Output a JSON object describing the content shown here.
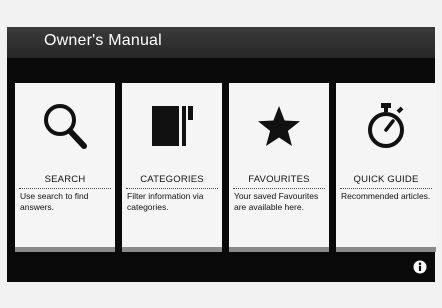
{
  "header": {
    "title": "Owner's Manual"
  },
  "cards": [
    {
      "label": "SEARCH",
      "description": "Use search to find answers.",
      "icon": "search-icon"
    },
    {
      "label": "CATEGORIES",
      "description": "Filter information via categories.",
      "icon": "categories-icon"
    },
    {
      "label": "FAVOURITES",
      "description": "Your saved Favourites are available here.",
      "icon": "star-icon"
    },
    {
      "label": "QUICK GUIDE",
      "description": "Recommended articles.",
      "icon": "stopwatch-icon"
    }
  ],
  "footer": {
    "info_icon": "info-icon"
  },
  "colors": {
    "screen": "#0a0a0a",
    "card": "#f5f5f5",
    "card_bar": "#8a8a8a",
    "title_bar": "#2f2f2f"
  }
}
